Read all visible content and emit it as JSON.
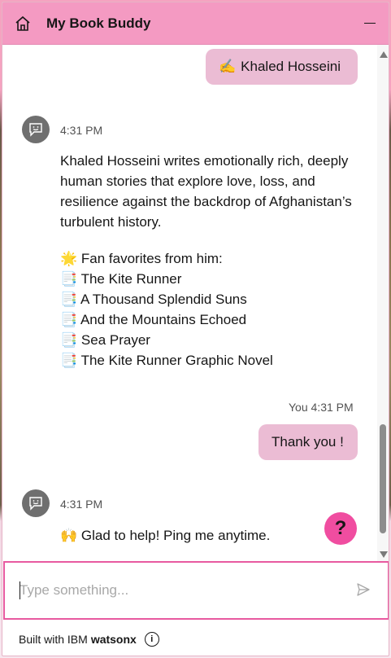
{
  "header": {
    "title": "My Book Buddy"
  },
  "messages": {
    "user1": {
      "emoji": "✍️",
      "text": "Khaled Hosseini"
    },
    "bot1": {
      "time": "4:31 PM",
      "paragraph": "Khaled Hosseini writes emotionally rich, deeply human stories that explore love, loss, and resilience against the backdrop of Afghanistan’s turbulent history.",
      "list_heading_emoji": "🌟",
      "list_heading": "Fan favorites from him:",
      "item_emoji": "📑",
      "items": [
        "The Kite Runner",
        "A Thousand Splendid Suns",
        "And the Mountains Echoed",
        "Sea Prayer",
        "The Kite Runner Graphic Novel"
      ]
    },
    "user2": {
      "meta": "You 4:31 PM",
      "text": "Thank you !"
    },
    "bot2": {
      "time": "4:31 PM",
      "emoji": "🙌",
      "text": "Glad to help! Ping me anytime."
    }
  },
  "help_button": {
    "label": "?"
  },
  "input": {
    "placeholder": "Type something..."
  },
  "footer": {
    "prefix": "Built with IBM",
    "brand": "watsonx",
    "info_label": "i"
  },
  "colors": {
    "header": "#f49ac2",
    "user_bubble": "#ebbcd4",
    "accent": "#e85aa0",
    "help": "#f04da0"
  }
}
